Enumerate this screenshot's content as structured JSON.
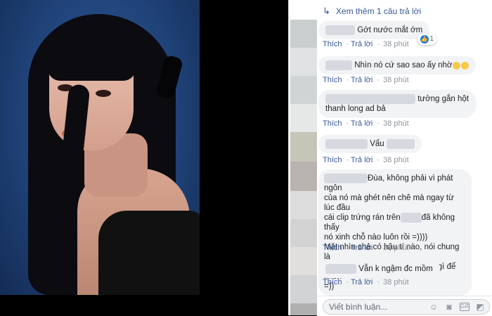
{
  "comments_panel": {
    "more_replies": "Xem thêm 1 câu trả lời",
    "actions": {
      "like": "Thích",
      "reply": "Trả lời"
    },
    "comments": [
      {
        "text": "Gớt nước mắt ớm",
        "time": "38 phút",
        "reaction_count": "1"
      },
      {
        "text": "Nhìn nó cứ sao sao ấy nhờ",
        "time": "38 phút"
      },
      {
        "text_line1": "tưởng gắn hột",
        "text_line2": "thanh long ad bả",
        "time": "38 phút"
      },
      {
        "text": "Vẩu",
        "time": "38 phút"
      },
      {
        "line1": "Đùa, không phải vì phát ngôn",
        "line2": "của nó mà ghét nên chê mà ngay từ lúc đầu",
        "line3a": "cái clip trứng rán trên",
        "line3b": "đã không thấy",
        "line4": "nó xinh chỗ nào luôn rồi =))))",
        "line5": "Mặt nhìn chả có hậu tí nào, nói chung là",
        "line6": "không xấu nhưng quá bth, k có gì để khen",
        "line7": "=))",
        "time": "38 phút"
      },
      {
        "text": "Vẫn k ngậm đc mồm",
        "time": "38 phút"
      }
    ],
    "composer": {
      "placeholder": "Viết bình luận..."
    }
  },
  "icons": [
    "reply-arrow-icon",
    "like-reaction-icon",
    "emoji-icon",
    "camera-icon",
    "gif-icon",
    "sticker-icon"
  ],
  "colors": {
    "link": "#385898",
    "bubble": "#f2f3f5",
    "meta": "#90949c",
    "like": "#1877f2"
  }
}
